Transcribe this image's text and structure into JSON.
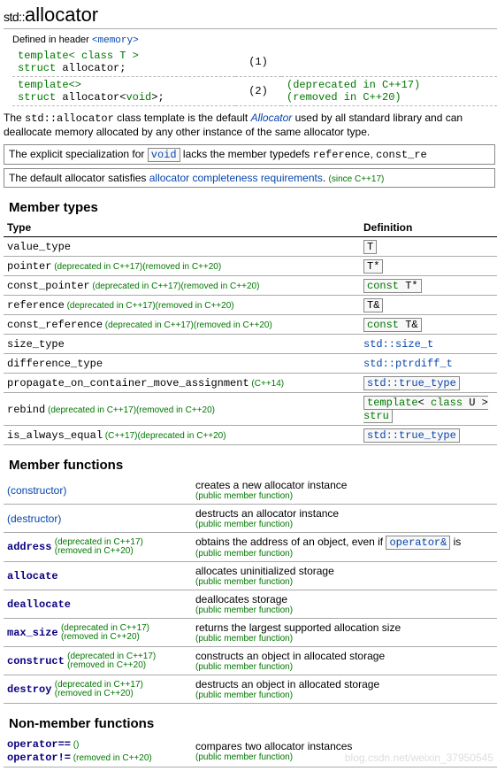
{
  "title": {
    "ns": "std::",
    "name": "allocator"
  },
  "header_line": {
    "prefix": "Defined in header ",
    "header": "<memory>"
  },
  "decls": [
    {
      "line1": "template< class T >",
      "line2a": "struct",
      "line2b": " allocator;",
      "num": "(1)",
      "note": ""
    },
    {
      "line1": "template<>",
      "line2a": "struct",
      "line2b": " allocator<",
      "line2c": "void",
      "line2d": ">;",
      "num": "(2)",
      "note1": "(deprecated in C++17)",
      "note2": "(removed in C++20)"
    }
  ],
  "para1": {
    "t1": "The ",
    "code": "std::allocator",
    "t2": " class template is the default ",
    "em": "Allocator",
    "t3": " used by all standard library and can deallocate memory allocated by any other instance of the same allocator type."
  },
  "box1": {
    "t1": "The explicit specialization for ",
    "code": "void",
    "t2": " lacks the member typedefs ",
    "m1": "reference",
    "m2": "const_re"
  },
  "box2": {
    "t1": "The default allocator satisfies ",
    "link": "allocator completeness requirements",
    "tail": ". ",
    "since": "(since C++17)"
  },
  "member_types": {
    "heading": "Member types",
    "col1": "Type",
    "col2": "Definition",
    "rows": [
      {
        "name": "value_type",
        "mark": "",
        "def": "T",
        "boxed": true
      },
      {
        "name": "pointer",
        "mark": "(deprecated in C++17)(removed in C++20)",
        "def": "T*",
        "boxed": true
      },
      {
        "name": "const_pointer",
        "mark": "(deprecated in C++17)(removed in C++20)",
        "def_kw": "const",
        "def_rest": " T*",
        "boxed": true
      },
      {
        "name": "reference",
        "mark": "(deprecated in C++17)(removed in C++20)",
        "def": "T&",
        "boxed": true
      },
      {
        "name": "const_reference",
        "mark": "(deprecated in C++17)(removed in C++20)",
        "def_kw": "const",
        "def_rest": " T&",
        "boxed": true
      },
      {
        "name": "size_type",
        "mark": "",
        "def_link": "std::size_t"
      },
      {
        "name": "difference_type",
        "mark": "",
        "def_link": "std::ptrdiff_t"
      },
      {
        "name": "propagate_on_container_move_assignment",
        "mark": "(C++14)",
        "def_link": "std::true_type",
        "boxed": true
      },
      {
        "name": "rebind",
        "mark": "(deprecated in C++17)(removed in C++20)",
        "def_tpl": true,
        "boxed": true
      },
      {
        "name": "is_always_equal",
        "mark": "(C++17)(deprecated in C++20)",
        "def_link": "std::true_type",
        "boxed": true
      }
    ]
  },
  "member_funcs": {
    "heading": "Member functions",
    "rows": [
      {
        "name": "(constructor)",
        "link": true,
        "mark": [],
        "desc": "creates a new allocator instance",
        "note": "(public member function)"
      },
      {
        "name": "(destructor)",
        "link": true,
        "mark": [],
        "desc": "destructs an allocator instance",
        "note": "(public member function)"
      },
      {
        "name": "address",
        "bold": true,
        "link": true,
        "mark": [
          "(deprecated in C++17)",
          "(removed in C++20)"
        ],
        "desc_parts": [
          "obtains the address of an object, even if ",
          "operator&",
          " is"
        ],
        "note": "(public member function)"
      },
      {
        "name": "allocate",
        "bold": true,
        "link": true,
        "mark": [],
        "desc": "allocates uninitialized storage",
        "note": "(public member function)"
      },
      {
        "name": "deallocate",
        "bold": true,
        "link": true,
        "mark": [],
        "desc": "deallocates storage",
        "note": "(public member function)"
      },
      {
        "name": "max_size",
        "bold": true,
        "link": true,
        "mark": [
          "(deprecated in C++17)",
          "(removed in C++20)"
        ],
        "desc": "returns the largest supported allocation size",
        "note": "(public member function)"
      },
      {
        "name": "construct",
        "bold": true,
        "link": true,
        "mark": [
          "(deprecated in C++17)",
          "(removed in C++20)"
        ],
        "desc": "constructs an object in allocated storage",
        "note": "(public member function)"
      },
      {
        "name": "destroy",
        "bold": true,
        "link": true,
        "mark": [
          "(deprecated in C++17)",
          "(removed in C++20)"
        ],
        "desc": "destructs an object in allocated storage",
        "note": "(public member function)"
      }
    ]
  },
  "nonmember_funcs": {
    "heading": "Non-member functions",
    "rows": [
      {
        "names": [
          "operator==",
          "operator!="
        ],
        "mark_extra": "()",
        "mark": [
          "(removed in C++20)"
        ],
        "desc": "compares two allocator instances",
        "note": "(public member function)"
      }
    ]
  },
  "watermark": "blog.csdn.net/weixin_37950545"
}
